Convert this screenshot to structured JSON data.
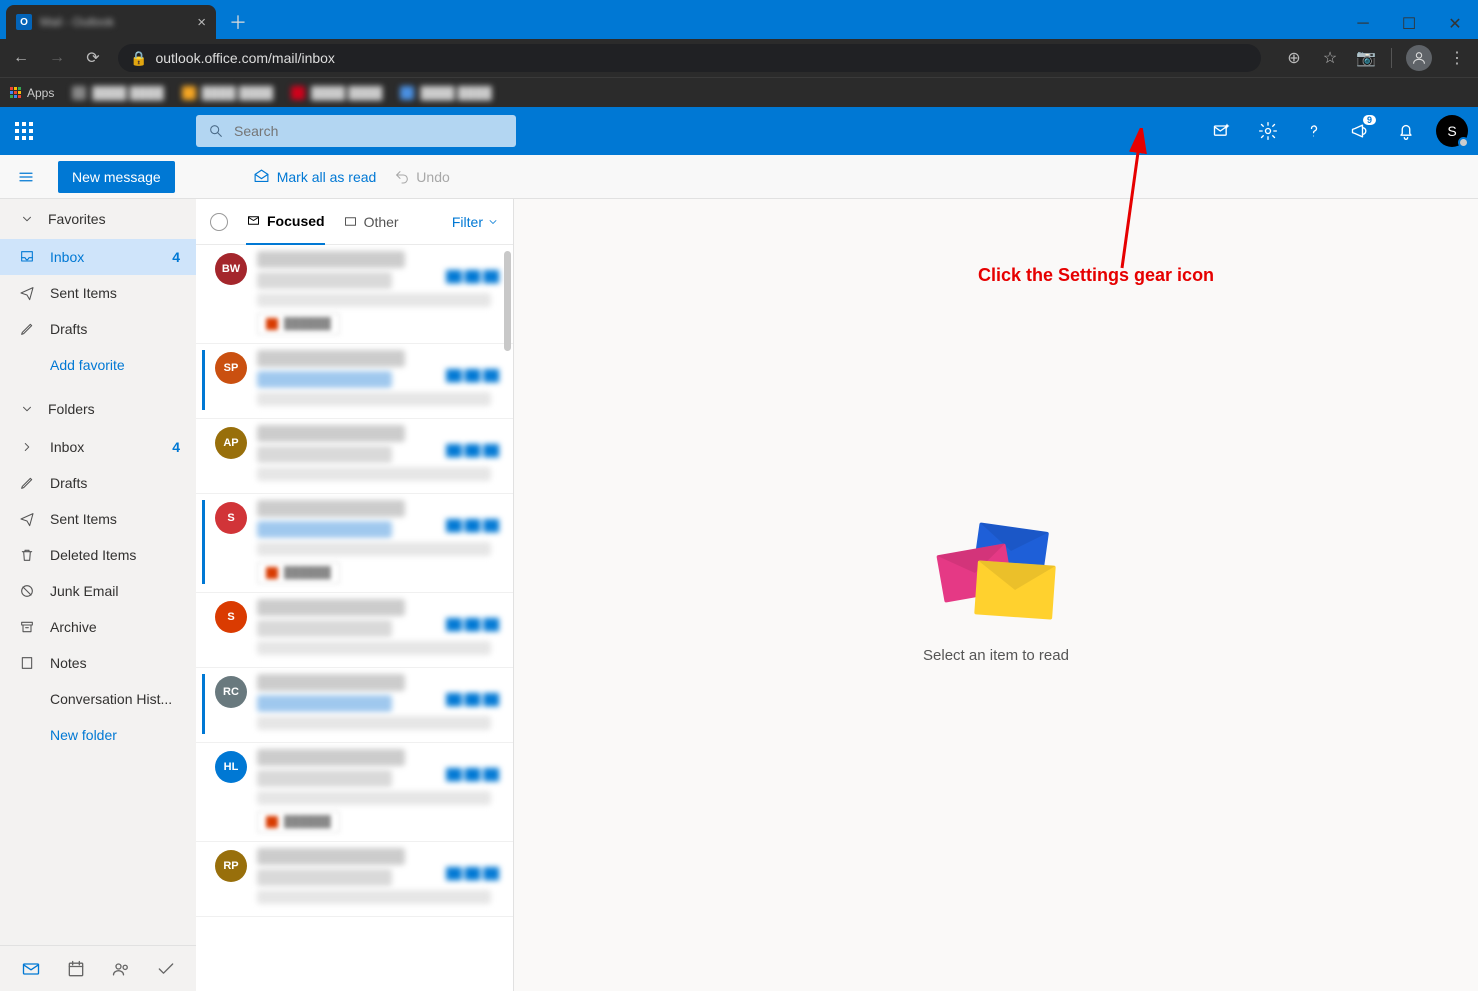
{
  "browser": {
    "tab_title": "Mail - Outlook",
    "url": "outlook.office.com/mail/inbox",
    "apps_label": "Apps"
  },
  "header": {
    "search_placeholder": "Search",
    "notification_count": "9",
    "user_initial": "S"
  },
  "cmdbar": {
    "new_message": "New message",
    "mark_all": "Mark all as read",
    "undo": "Undo"
  },
  "nav": {
    "favorites_label": "Favorites",
    "folders_label": "Folders",
    "add_favorite": "Add favorite",
    "new_folder": "New folder",
    "favorites": [
      {
        "label": "Inbox",
        "icon": "inbox",
        "count": "4",
        "selected": true
      },
      {
        "label": "Sent Items",
        "icon": "send",
        "count": ""
      },
      {
        "label": "Drafts",
        "icon": "pencil",
        "count": ""
      }
    ],
    "folders": [
      {
        "label": "Inbox",
        "icon": "chevright",
        "count": "4"
      },
      {
        "label": "Drafts",
        "icon": "pencil",
        "count": ""
      },
      {
        "label": "Sent Items",
        "icon": "send",
        "count": ""
      },
      {
        "label": "Deleted Items",
        "icon": "trash",
        "count": ""
      },
      {
        "label": "Junk Email",
        "icon": "block",
        "count": ""
      },
      {
        "label": "Archive",
        "icon": "archive",
        "count": ""
      },
      {
        "label": "Notes",
        "icon": "note",
        "count": ""
      },
      {
        "label": "Conversation Hist...",
        "icon": "",
        "count": ""
      }
    ]
  },
  "list": {
    "focused": "Focused",
    "other": "Other",
    "filter": "Filter",
    "messages": [
      {
        "initials": "BW",
        "color": "#a4262c",
        "unread": false,
        "attachment": true
      },
      {
        "initials": "SP",
        "color": "#ca5010",
        "unread": true,
        "attachment": false
      },
      {
        "initials": "AP",
        "color": "#986f0b",
        "unread": false,
        "attachment": false
      },
      {
        "initials": "S",
        "color": "#d13438",
        "unread": true,
        "attachment": true
      },
      {
        "initials": "S",
        "color": "#da3b01",
        "unread": false,
        "attachment": false
      },
      {
        "initials": "RC",
        "color": "#69797e",
        "unread": true,
        "attachment": false
      },
      {
        "initials": "HL",
        "color": "#0078d4",
        "unread": false,
        "attachment": true
      },
      {
        "initials": "RP",
        "color": "#986f0b",
        "unread": false,
        "attachment": false
      }
    ]
  },
  "reading": {
    "placeholder": "Select an item to read"
  },
  "annotation": {
    "text": "Click the Settings gear icon"
  }
}
